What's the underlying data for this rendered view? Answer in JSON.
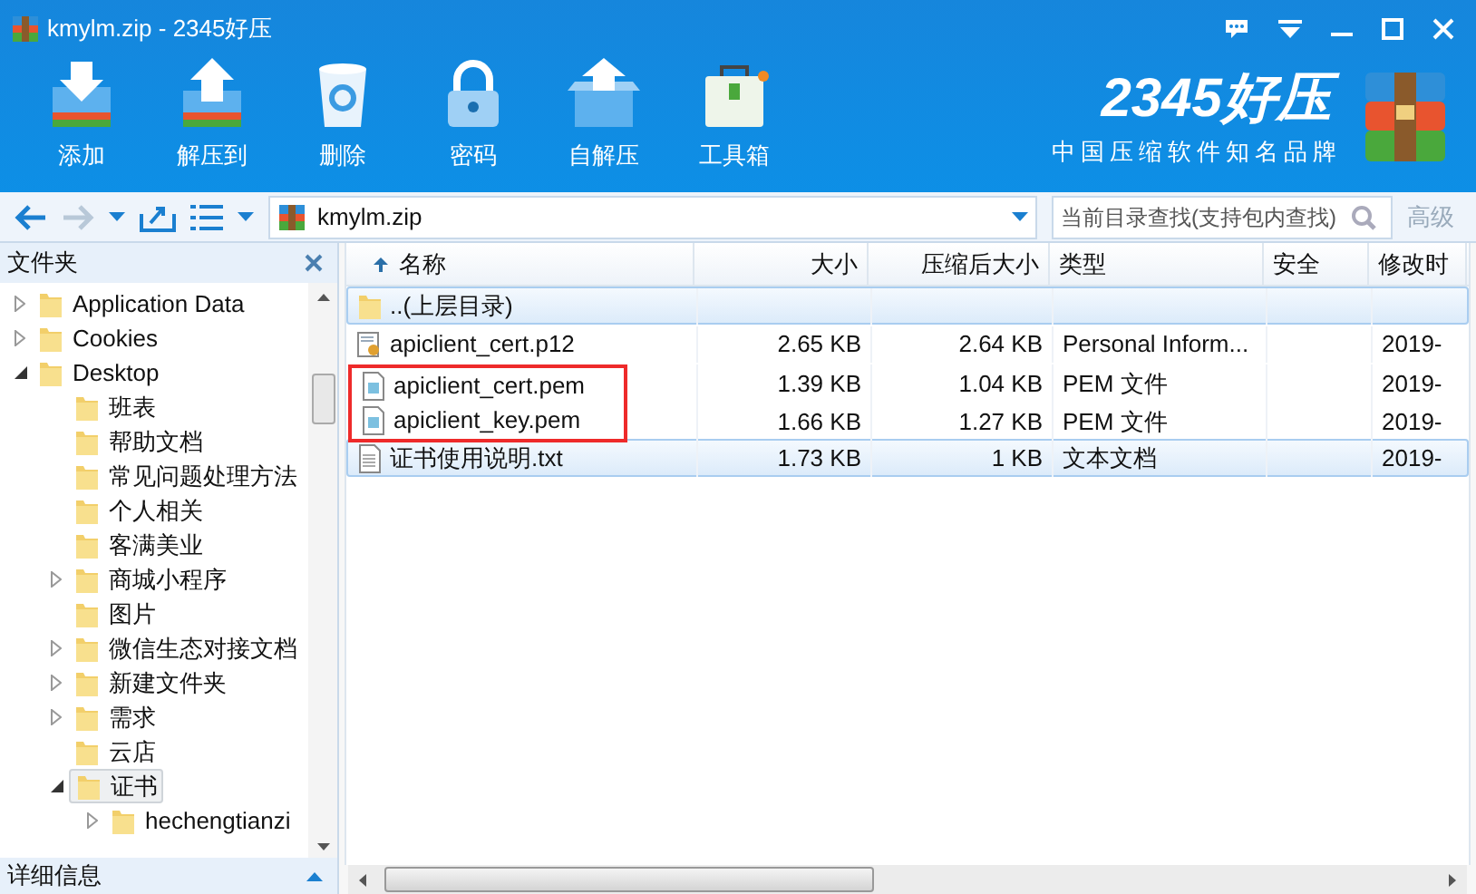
{
  "window": {
    "title": "kmylm.zip - 2345好压"
  },
  "toolbar": [
    {
      "kind": "add",
      "label": "添加"
    },
    {
      "kind": "extract",
      "label": "解压到"
    },
    {
      "kind": "delete",
      "label": "删除"
    },
    {
      "kind": "password",
      "label": "密码"
    },
    {
      "kind": "selfextract",
      "label": "自解压"
    },
    {
      "kind": "tools",
      "label": "工具箱"
    }
  ],
  "brand": {
    "name": "2345好压",
    "slogan": "中国压缩软件知名品牌"
  },
  "path": {
    "value": "kmylm.zip"
  },
  "search": {
    "placeholder": "当前目录查找(支持包内查找)",
    "advanced": "高级"
  },
  "folders": {
    "title": "文件夹",
    "items": [
      {
        "label": "Application Data",
        "expandable": true,
        "expanded": false,
        "selected": false
      },
      {
        "label": "Cookies",
        "expandable": true,
        "expanded": false,
        "selected": false
      },
      {
        "label": "Desktop",
        "expandable": true,
        "expanded": true,
        "selected": false,
        "children": [
          {
            "label": "班表",
            "expandable": false,
            "selected": false
          },
          {
            "label": "帮助文档",
            "expandable": false,
            "selected": false
          },
          {
            "label": "常见问题处理方法",
            "expandable": false,
            "selected": false
          },
          {
            "label": "个人相关",
            "expandable": false,
            "selected": false
          },
          {
            "label": "客满美业",
            "expandable": false,
            "selected": false
          },
          {
            "label": "商城小程序",
            "expandable": true,
            "expanded": false,
            "selected": false
          },
          {
            "label": "图片",
            "expandable": false,
            "selected": false
          },
          {
            "label": "微信生态对接文档",
            "expandable": true,
            "expanded": false,
            "selected": false
          },
          {
            "label": "新建文件夹",
            "expandable": true,
            "expanded": false,
            "selected": false
          },
          {
            "label": "需求",
            "expandable": true,
            "expanded": false,
            "selected": false
          },
          {
            "label": "云店",
            "expandable": false,
            "selected": false
          },
          {
            "label": "证书",
            "expandable": true,
            "expanded": true,
            "selected": true,
            "children": [
              {
                "label": "hechengtianzi",
                "expandable": true,
                "expanded": false,
                "selected": false
              }
            ]
          }
        ]
      }
    ]
  },
  "details": {
    "label": "详细信息"
  },
  "table": {
    "columns": [
      "名称",
      "大小",
      "压缩后大小",
      "类型",
      "安全",
      "修改时"
    ],
    "rows": [
      {
        "kind": "parent",
        "name": "..(上层目录)",
        "size": "",
        "packed": "",
        "type": "",
        "modified": "",
        "selected": true,
        "marked": false
      },
      {
        "kind": "cert",
        "name": "apiclient_cert.p12",
        "size": "2.65 KB",
        "packed": "2.64 KB",
        "type": "Personal Inform...",
        "modified": "2019-",
        "selected": false,
        "marked": false
      },
      {
        "kind": "file",
        "name": "apiclient_cert.pem",
        "size": "1.39 KB",
        "packed": "1.04 KB",
        "type": "PEM 文件",
        "modified": "2019-",
        "selected": false,
        "marked": true
      },
      {
        "kind": "file",
        "name": "apiclient_key.pem",
        "size": "1.66 KB",
        "packed": "1.27 KB",
        "type": "PEM 文件",
        "modified": "2019-",
        "selected": false,
        "marked": true
      },
      {
        "kind": "text",
        "name": "证书使用说明.txt",
        "size": "1.73 KB",
        "packed": "1 KB",
        "type": "文本文档",
        "modified": "2019-",
        "selected": true,
        "marked": false
      }
    ]
  }
}
